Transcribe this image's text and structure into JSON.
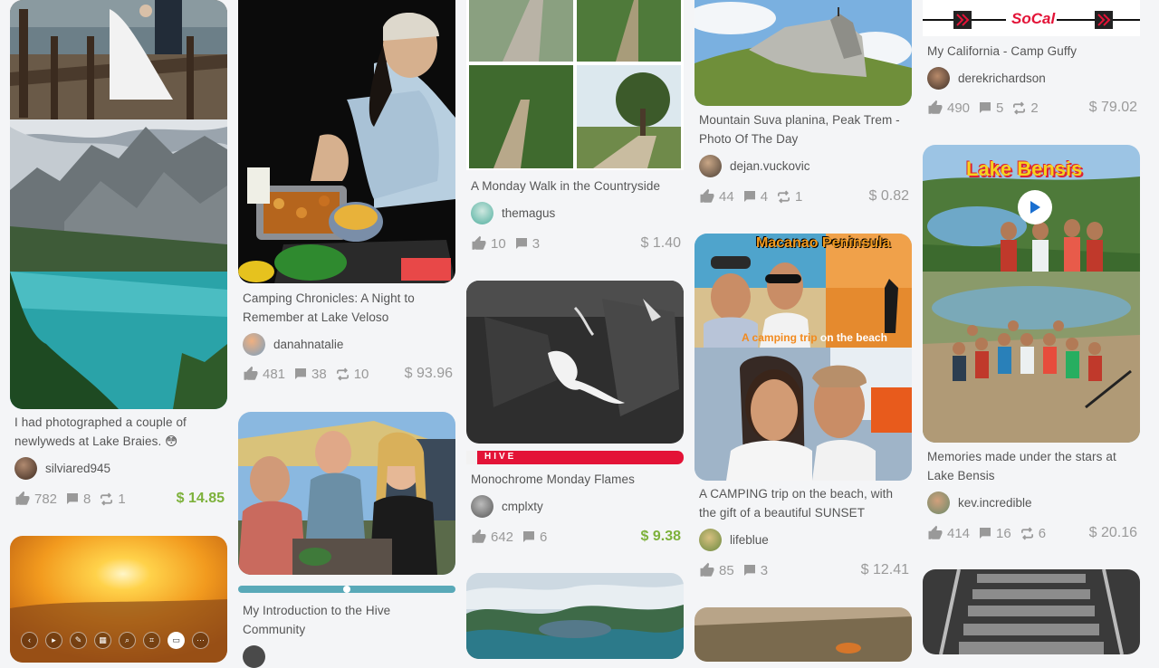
{
  "posts": [
    {
      "title": "I had photographed a couple of newlyweds at Lake Braies. 😳",
      "author": "silviared945",
      "votes": "782",
      "comments": "8",
      "reblogs": "1",
      "payout": "$ 14.85"
    },
    {
      "title": "Camping Chronicles: A Night to Remember at Lake Veloso",
      "author": "danahnatalie",
      "votes": "481",
      "comments": "38",
      "reblogs": "10",
      "payout": "$ 93.96"
    },
    {
      "title": "My Introduction to the Hive Community",
      "author": ""
    },
    {
      "title": "A Monday Walk in the Countryside",
      "author": "themagus",
      "votes": "10",
      "comments": "3",
      "payout": "$ 1.40"
    },
    {
      "title": "Monochrome Monday Flames",
      "author": "cmplxty",
      "votes": "642",
      "comments": "6",
      "payout": "$ 9.38",
      "banner_text": "HIVE"
    },
    {
      "title": "Mountain Suva planina, Peak Trem - Photo Of The Day",
      "author": "dejan.vuckovic",
      "votes": "44",
      "comments": "4",
      "reblogs": "1",
      "payout": "$ 0.82"
    },
    {
      "title": "A CAMPING trip on the beach, with the gift of a beautiful SUNSET",
      "author": "lifeblue",
      "votes": "85",
      "comments": "3",
      "payout": "$ 12.41",
      "overlay_title": "Macanao Peninsula",
      "overlay_caption_a": "A camping trip",
      "overlay_caption_b": "on the beach"
    },
    {
      "title": "My California - Camp Guffy",
      "author": "derekrichardson",
      "votes": "490",
      "comments": "5",
      "reblogs": "2",
      "payout": "$ 79.02",
      "banner_text": "SoCal"
    },
    {
      "title": "Memories made under the stars at Lake Bensis",
      "author": "kev.incredible",
      "votes": "414",
      "comments": "16",
      "reblogs": "6",
      "payout": "$ 20.16",
      "overlay_title": "Lake Bensis"
    }
  ],
  "colors": {
    "accent_green": "#7db13b",
    "hive_red": "#e31337",
    "muted": "#999999"
  },
  "icons": {
    "vote": "thumbs-up-icon",
    "comment": "comment-icon",
    "reblog": "reblog-icon",
    "play": "play-icon"
  },
  "media_toolbar": [
    "back-icon",
    "play-icon",
    "pencil-icon",
    "grid-icon",
    "search-icon",
    "crop-icon",
    "video-icon",
    "more-icon"
  ]
}
